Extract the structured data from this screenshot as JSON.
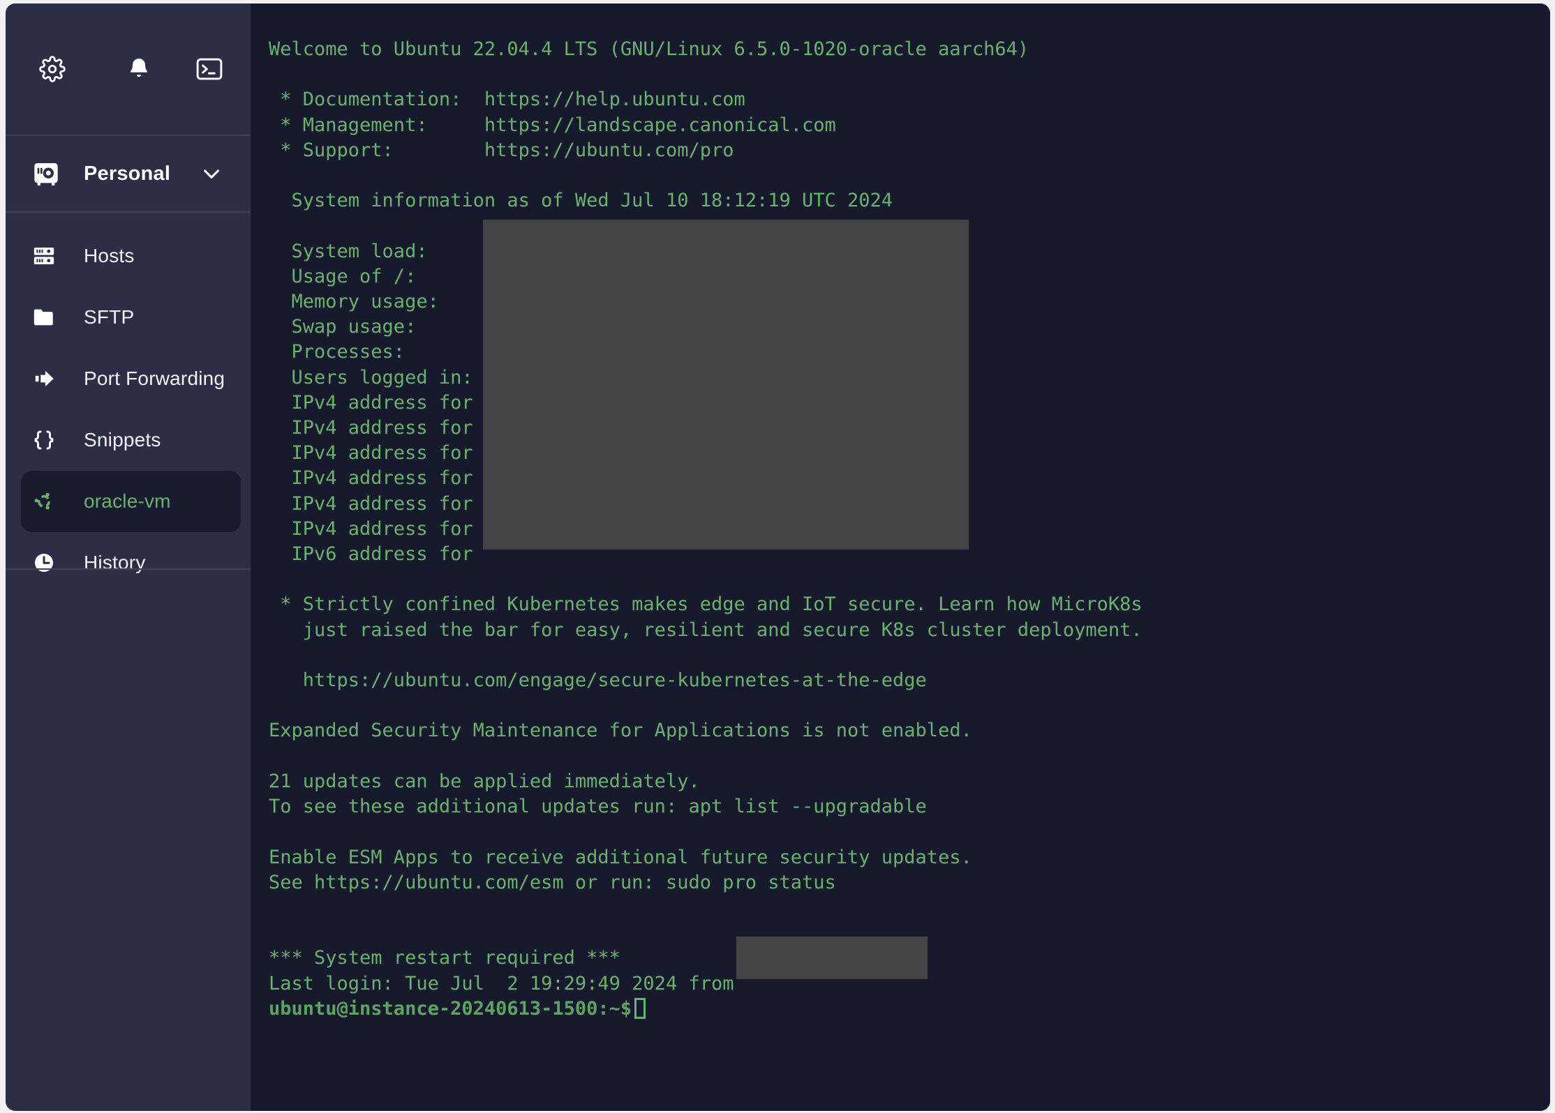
{
  "sidebar": {
    "toolbar": {
      "settings_icon": "gear-icon",
      "notifications_icon": "bell-icon",
      "terminal_icon": "terminal-icon"
    },
    "workspace": {
      "label": "Personal",
      "icon": "vault-icon",
      "chevron": "chevron-down-icon"
    },
    "items": [
      {
        "label": "Hosts",
        "icon": "server-rack-icon",
        "active": false
      },
      {
        "label": "SFTP",
        "icon": "folder-icon",
        "active": false
      },
      {
        "label": "Port Forwarding",
        "icon": "arrow-forward-icon",
        "active": false
      },
      {
        "label": "Snippets",
        "icon": "braces-icon",
        "active": false
      },
      {
        "label": "oracle-vm",
        "icon": "ubuntu-logo-icon",
        "active": true
      },
      {
        "label": "History",
        "icon": "clock-icon",
        "active": false
      }
    ]
  },
  "terminal": {
    "lines": [
      "Welcome to Ubuntu 22.04.4 LTS (GNU/Linux 6.5.0-1020-oracle aarch64)",
      "",
      " * Documentation:  https://help.ubuntu.com",
      " * Management:     https://landscape.canonical.com",
      " * Support:        https://ubuntu.com/pro",
      "",
      "  System information as of Wed Jul 10 18:12:19 UTC 2024",
      "",
      "  System load:",
      "  Usage of /:",
      "  Memory usage:",
      "  Swap usage:",
      "  Processes:",
      "  Users logged in:",
      "  IPv4 address for",
      "  IPv4 address for",
      "  IPv4 address for",
      "  IPv4 address for",
      "  IPv4 address for",
      "  IPv4 address for",
      "  IPv6 address for",
      "",
      " * Strictly confined Kubernetes makes edge and IoT secure. Learn how MicroK8s",
      "   just raised the bar for easy, resilient and secure K8s cluster deployment.",
      "",
      "   https://ubuntu.com/engage/secure-kubernetes-at-the-edge",
      "",
      "Expanded Security Maintenance for Applications is not enabled.",
      "",
      "21 updates can be applied immediately.",
      "To see these additional updates run: apt list --upgradable",
      "",
      "Enable ESM Apps to receive additional future security updates.",
      "See https://ubuntu.com/esm or run: sudo pro status",
      "",
      "",
      "*** System restart required ***",
      "Last login: Tue Jul  2 19:29:49 2024 from"
    ],
    "prompt": "ubuntu@instance-20240613-1500:~$",
    "redactions": [
      "system-info-values-redaction",
      "last-login-host-redaction"
    ]
  },
  "colors": {
    "sidebar_bg": "#2b2e45",
    "terminal_bg": "#171a2c",
    "terminal_green": "#6ab06f",
    "active_item_bg": "#191b2e",
    "divider": "#3d4157",
    "redaction_gray": "#444447"
  }
}
